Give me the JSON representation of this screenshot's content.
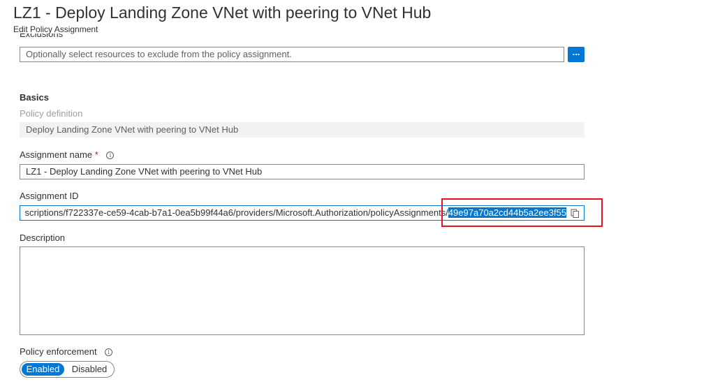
{
  "header": {
    "title": "LZ1 - Deploy Landing Zone VNet with peering to VNet Hub",
    "subtitle": "Edit Policy Assignment"
  },
  "exclusions": {
    "label": "Exclusions",
    "placeholder": "Optionally select resources to exclude from the policy assignment.",
    "browse_label": "..."
  },
  "basics": {
    "heading": "Basics",
    "policy_definition_label": "Policy definition",
    "policy_definition_value": "Deploy Landing Zone VNet with peering to VNet Hub",
    "assignment_name_label": "Assignment name",
    "required_marker": "*",
    "assignment_name_value": "LZ1 - Deploy Landing Zone VNet with peering to VNet Hub",
    "assignment_id_label": "Assignment ID",
    "assignment_id_prefix": "scriptions/f722337e-ce59-4cab-b7a1-0ea5b99f44a6/providers/Microsoft.Authorization/policyAssignment",
    "assignment_id_sep": "s/",
    "assignment_id_selected": "49e97a70a2cd44b5a2ee3f55",
    "description_label": "Description",
    "description_value": "",
    "enforcement_label": "Policy enforcement",
    "enforcement_options": [
      "Enabled",
      "Disabled"
    ],
    "enforcement_selected": "Enabled"
  },
  "icons": {
    "info": "i",
    "copy": "copy-icon"
  },
  "colors": {
    "accent": "#0078d4",
    "highlight_border": "#e81123",
    "readonly_bg": "#f3f2f1",
    "required": "#a4262c"
  }
}
